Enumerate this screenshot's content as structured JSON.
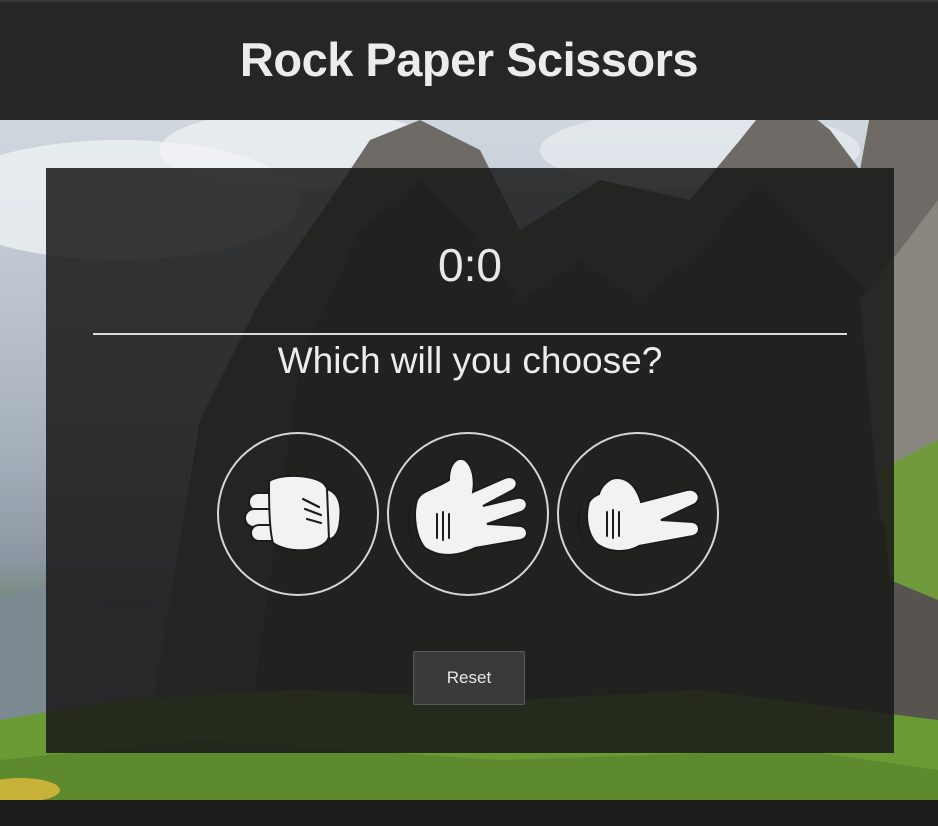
{
  "header": {
    "title": "Rock Paper Scissors"
  },
  "game": {
    "score": "0:0",
    "prompt": "Which will you choose?",
    "choices": [
      {
        "id": "rock",
        "icon": "rock-hand-icon"
      },
      {
        "id": "paper",
        "icon": "paper-hand-icon"
      },
      {
        "id": "scissors",
        "icon": "scissors-hand-icon"
      }
    ],
    "reset_label": "Reset"
  },
  "colors": {
    "header_bg": "#262626",
    "panel_bg": "rgba(25,25,25,0.86)",
    "text": "#ececec",
    "icon_fill": "#f2f2f2"
  }
}
